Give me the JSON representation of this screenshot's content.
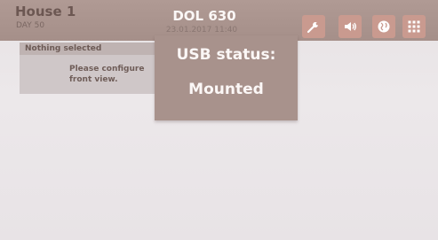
{
  "header": {
    "house_title": "House 1",
    "day_label": "DAY 50",
    "device_title": "DOL 630",
    "datetime": "23.01.2017 11:40"
  },
  "toolbar": {
    "icons": [
      "wrench-icon",
      "speaker-icon",
      "globe-icon",
      "grid-menu-icon"
    ]
  },
  "panel": {
    "header": "Nothing selected",
    "message": "Please configure\nfront view."
  },
  "usb_popup": {
    "title": "USB status:",
    "state": "Mounted"
  },
  "colors": {
    "topbar": "#a8928c",
    "button": "#c99a8f",
    "text_light": "#fbf7f6"
  }
}
